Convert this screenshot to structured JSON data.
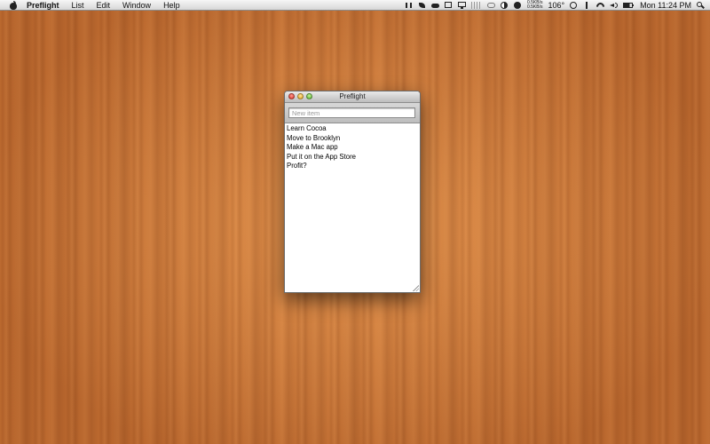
{
  "menubar": {
    "app_name": "Preflight",
    "menus": [
      "List",
      "Edit",
      "Window",
      "Help"
    ],
    "status": {
      "net_up": "0.5KB/s",
      "net_down": "0.5KB/s",
      "temperature": "106°",
      "clock": "Mon 11:24 PM"
    }
  },
  "window": {
    "title": "Preflight",
    "new_item_placeholder": "New item",
    "new_item_value": "",
    "items": [
      "Learn Cocoa",
      "Move to Brooklyn",
      "Make a Mac app",
      "Put it on the App Store",
      "Profit?"
    ]
  }
}
